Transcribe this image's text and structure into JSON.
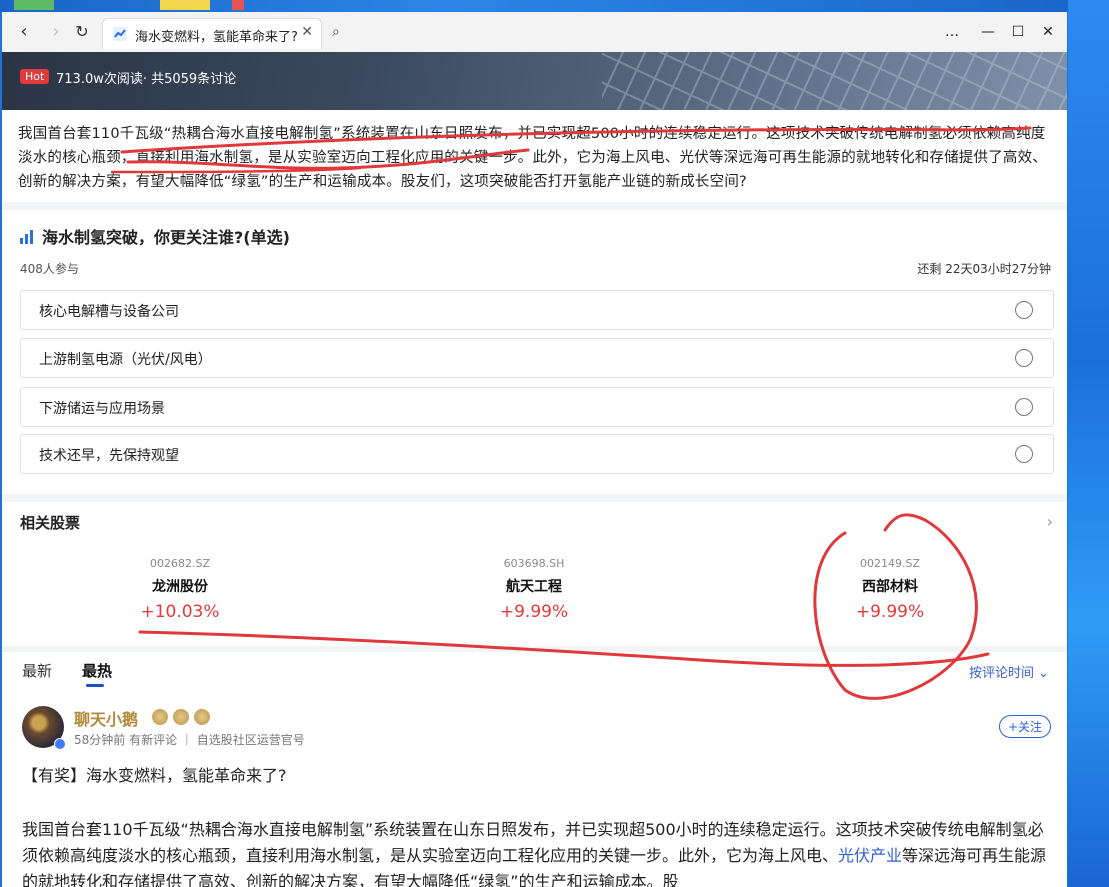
{
  "browser": {
    "tab_title": "海水变燃料，氢能革命来了?",
    "tab_close": "✕",
    "nav_back": "‹",
    "nav_forward": "›",
    "nav_reload": "↻",
    "search_icon": "⌕",
    "menu": "…",
    "minimize": "—",
    "maximize": "☐",
    "close": "✕"
  },
  "hero": {
    "badge": "Hot",
    "stats": "713.0w次阅读· 共5059条讨论"
  },
  "intro": {
    "text": "我国首台套110千瓦级“热耦合海水直接电解制氢”系统装置在山东日照发布，并已实现超500小时的连续稳定运行。这项技术突破传统电解制氢必须依赖高纯度淡水的核心瓶颈，直接利用海水制氢，是从实验室迈向工程化应用的关键一步。此外，它为海上风电、光伏等深远海可再生能源的就地转化和存储提供了高效、创新的解决方案，有望大幅降低“绿氢”的生产和运输成本。股友们，这项突破能否打开氢能产业链的新成长空间?"
  },
  "poll": {
    "title": "海水制氢突破，你更关注谁?(单选)",
    "participants": "408人参与",
    "remaining": "还剩 22天03小时27分钟",
    "options": [
      {
        "label": "核心电解槽与设备公司"
      },
      {
        "label": "上游制氢电源（光伏/风电）"
      },
      {
        "label": "下游储运与应用场景"
      },
      {
        "label": "技术还早，先保持观望"
      }
    ]
  },
  "stocks": {
    "title": "相关股票",
    "arrow": "›",
    "items": [
      {
        "code": "002682.SZ",
        "name": "龙洲股份",
        "change": "+10.03%"
      },
      {
        "code": "603698.SH",
        "name": "航天工程",
        "change": "+9.99%"
      },
      {
        "code": "002149.SZ",
        "name": "西部材料",
        "change": "+9.99%"
      }
    ]
  },
  "feed": {
    "tab_latest": "最新",
    "tab_hot": "最热",
    "sort": "按评论时间 ⌄"
  },
  "post": {
    "author": "聊天小鹅",
    "meta": "58分钟前 有新评论 ｜ 自选股社区运营官号",
    "follow": "+关注",
    "title": "【有奖】海水变燃料，氢能革命来了?",
    "body_pre": "我国首台套110千瓦级“热耦合海水直接电解制氢”系统装置在山东日照发布，并已实现超500小时的连续稳定运行。这项技术突破传统电解制氢必须依赖高纯度淡水的核心瓶颈，直接利用海水制氢，是从实验室迈向工程化应用的关键一步。此外，它为海上风电、",
    "body_link": "光伏产业",
    "body_post": "等深远海可再生能源的就地转化和存储提供了高效、创新的解决方案，有望大幅降低“绿氢”的生产和运输成本。股"
  },
  "colors": {
    "accent_red": "#e23a3a",
    "link_blue": "#2d5fd6",
    "annotation_red": "#e0393b"
  }
}
